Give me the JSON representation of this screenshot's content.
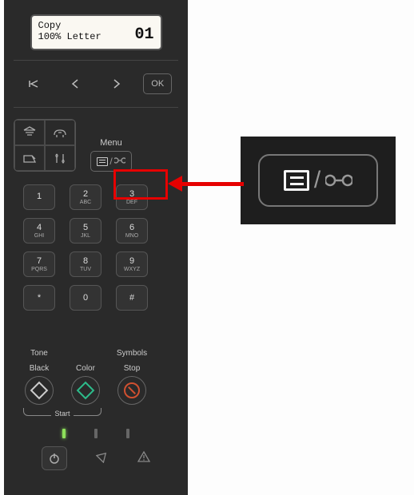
{
  "lcd": {
    "line1": "Copy",
    "line2": "100% Letter",
    "counter": "01"
  },
  "nav": {
    "ok": "OK"
  },
  "menu": {
    "label": "Menu"
  },
  "keypad": [
    {
      "num": "1",
      "sub": ""
    },
    {
      "num": "2",
      "sub": "ABC"
    },
    {
      "num": "3",
      "sub": "DEF"
    },
    {
      "num": "4",
      "sub": "GHI"
    },
    {
      "num": "5",
      "sub": "JKL"
    },
    {
      "num": "6",
      "sub": "MNO"
    },
    {
      "num": "7",
      "sub": "PQRS"
    },
    {
      "num": "8",
      "sub": "TUV"
    },
    {
      "num": "9",
      "sub": "WXYZ"
    },
    {
      "num": "*",
      "sub": ""
    },
    {
      "num": "0",
      "sub": ""
    },
    {
      "num": "#",
      "sub": ""
    }
  ],
  "keypad_labels": {
    "tone": "Tone",
    "symbols": "Symbols"
  },
  "action": {
    "black": "Black",
    "color": "Color",
    "stop": "Stop",
    "start": "Start"
  }
}
